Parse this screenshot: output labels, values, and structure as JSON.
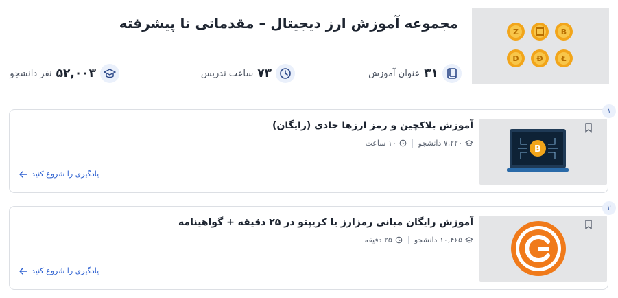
{
  "header": {
    "title": "مجموعه آموزش ارز دیجیتال – مقدماتی تا پیشرفته",
    "stats": {
      "courses": {
        "num": "۳۱",
        "label": "عنوان آموزش"
      },
      "hours": {
        "num": "۷۳",
        "label": "ساعت تدریس"
      },
      "students": {
        "num": "۵۲,۰۰۳",
        "label": "نفر دانشجو"
      }
    }
  },
  "courses": [
    {
      "index": "۱",
      "title": "آموزش بلاکچین و رمز ارزها جادی (رایگان)",
      "students": "۷,۲۲۰ دانشجو",
      "duration": "۱۰ ساعت",
      "cta": "یادگیری را شروع کنید"
    },
    {
      "index": "۲",
      "title": "آموزش رایگان مبانی رمزارز یا کریپتو در ۲۵ دقیقه + گواهینامه",
      "students": "۱۰,۴۶۵ دانشجو",
      "duration": "۲۵ دقیقه",
      "cta": "یادگیری را شروع کنید"
    }
  ],
  "colors": {
    "accent": "#2b5fd0",
    "coin": "#f2a51a",
    "icon_bg": "#eaf0fb"
  }
}
